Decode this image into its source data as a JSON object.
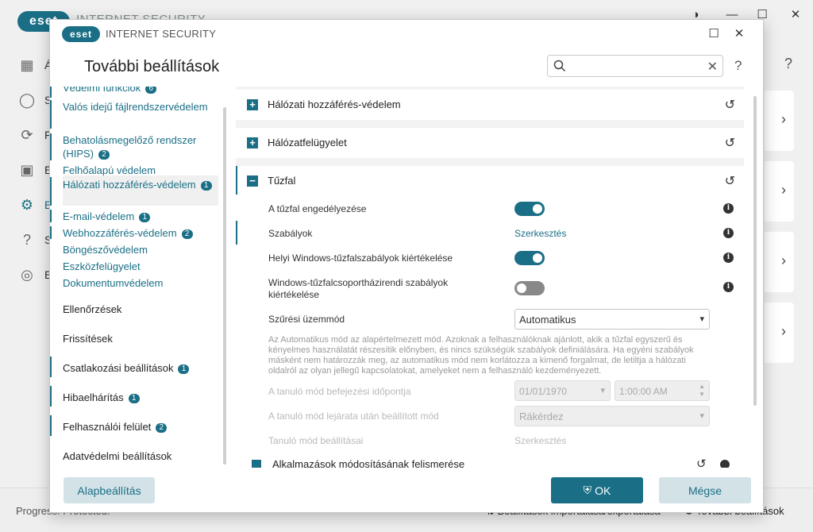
{
  "background": {
    "logo_text": "eset",
    "product": "INTERNET SECURITY",
    "sidebar_letters": [
      "Á",
      "S",
      "F",
      "E",
      "B",
      "S",
      "E"
    ],
    "help": "?",
    "footer": {
      "progress": "Progress. Protected.",
      "import_export": "Beállítások importálása/exportálása",
      "advanced": "További beállítások"
    }
  },
  "dialog": {
    "logo_text": "eset",
    "product": "INTERNET SECURITY",
    "title": "További beállítások",
    "search": {
      "value": "",
      "placeholder": ""
    },
    "help": "?",
    "nav": {
      "items": [
        {
          "label": "Védelmi funkciók",
          "badge": "6"
        },
        {
          "label": "Valós idejű fájlrendszervédelem",
          "badge": ""
        },
        {
          "label": "Behatolásmegelőző rendszer (HIPS)",
          "badge": "2"
        },
        {
          "label": "Felhőalapú védelem",
          "badge": ""
        },
        {
          "label": "Hálózati hozzáférés-védelem",
          "badge": "1"
        },
        {
          "label": "E-mail-védelem",
          "badge": "1"
        },
        {
          "label": "Webhozzáférés-védelem",
          "badge": "2"
        },
        {
          "label": "Böngészővédelem",
          "badge": ""
        },
        {
          "label": "Eszközfelügyelet",
          "badge": ""
        },
        {
          "label": "Dokumentumvédelem",
          "badge": ""
        }
      ],
      "categories": [
        {
          "label": "Ellenőrzések",
          "badge": ""
        },
        {
          "label": "Frissítések",
          "badge": ""
        },
        {
          "label": "Csatlakozási beállítások",
          "badge": "1"
        },
        {
          "label": "Hibaelhárítás",
          "badge": "1"
        },
        {
          "label": "Felhasználói felület",
          "badge": "2"
        },
        {
          "label": "Adatvédelmi beállítások",
          "badge": ""
        }
      ]
    },
    "sections": {
      "network_access": "Hálózati hozzáférés-védelem",
      "network_monitor": "Hálózatfelügyelet",
      "firewall": "Tűzfal",
      "next": "Alkalmazások módosításának felismerése"
    },
    "firewall": {
      "enable_label": "A tűzfal engedélyezése",
      "enable_state": true,
      "rules_label": "Szabályok",
      "rules_link": "Szerkesztés",
      "local_rules_label": "Helyi Windows-tűzfalszabályok kiértékelése",
      "local_rules_state": true,
      "group_policy_label": "Windows-tűzfalcsoportházirendi szabályok kiértékelése",
      "group_policy_state": false,
      "filter_mode_label": "Szűrési üzemmód",
      "filter_mode_value": "Automatikus",
      "description": "Az Automatikus mód az alapértelmezett mód. Azoknak a felhasználóknak ajánlott, akik a tűzfal egyszerű és kényelmes használatát részesítik előnyben, és nincs szükségük szabályok definiálására. Ha egyéni szabályok másként nem határozzák meg, az automatikus mód nem korlátozza a kimenő forgalmat, de letiltja a hálózati oldalról az olyan jellegű kapcsolatokat, amelyeket nem a felhasználó kezdeményezett.",
      "learning_end_label": "A tanuló mód befejezési időpontja",
      "learning_end_date": "01/01/1970",
      "learning_end_time": "1:00:00 AM",
      "after_learning_label": "A tanuló mód lejárata után beállított mód",
      "after_learning_value": "Rákérdez",
      "learning_settings_label": "Tanuló mód beállításai",
      "learning_settings_link": "Szerkesztés"
    },
    "buttons": {
      "defaults": "Alapbeállítás",
      "ok": "OK",
      "cancel": "Mégse"
    }
  },
  "colors": {
    "accent": "#1a6f86",
    "accent_light": "#d3e2e7"
  }
}
